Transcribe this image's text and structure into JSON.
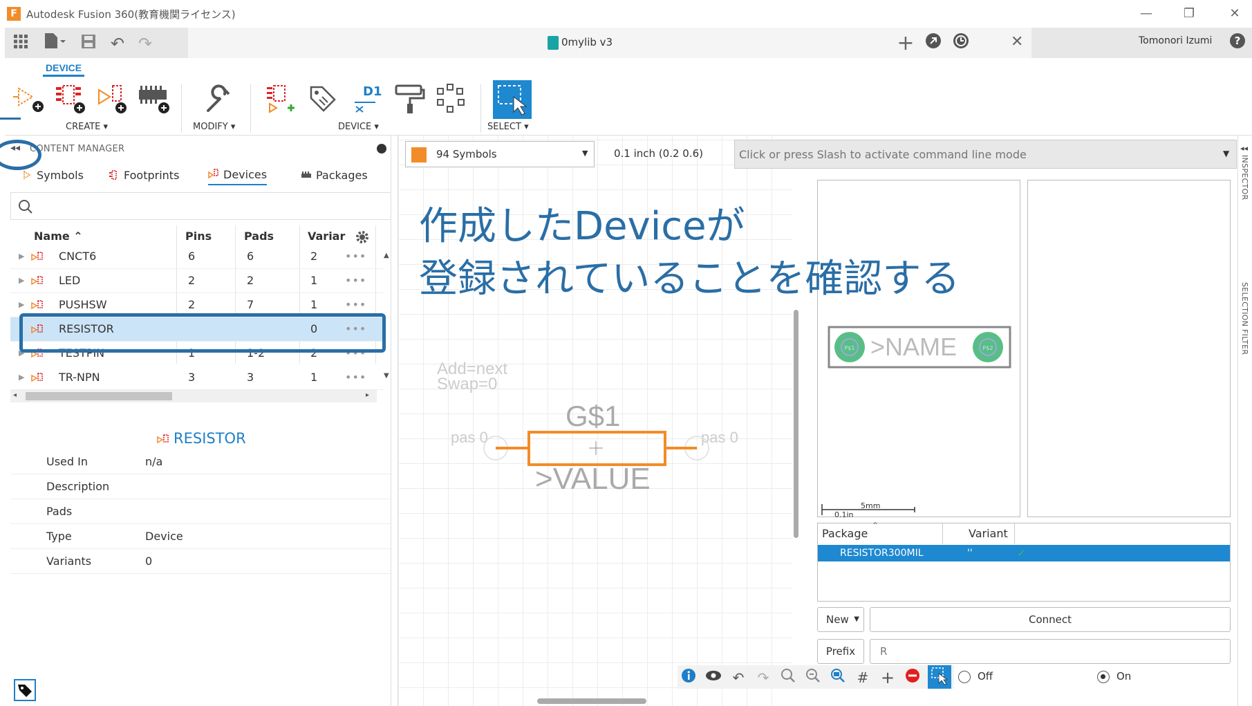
{
  "window": {
    "title": "Autodesk Fusion 360(教育機関ライセンス)",
    "app_icon": "F"
  },
  "tabbar": {
    "document_name": "0mylib v3",
    "user_name": "Tomonori Izumi"
  },
  "ribbon": {
    "active_tab": "DEVICE",
    "groups": {
      "create": "CREATE ▾",
      "modify": "MODIFY ▾",
      "device": "DEVICE ▾",
      "select": "SELECT ▾"
    },
    "d1_label": "D1"
  },
  "content_manager": {
    "title": "CONTENT MANAGER",
    "tabs": [
      "Symbols",
      "Footprints",
      "Devices",
      "Packages"
    ],
    "active_tab": "Devices",
    "columns": [
      "Name ⌃",
      "Pins",
      "Pads",
      "Variar"
    ],
    "rows": [
      {
        "name": "CNCT6",
        "pins": "6",
        "pads": "6",
        "variants": "2"
      },
      {
        "name": "LED",
        "pins": "2",
        "pads": "2",
        "variants": "1"
      },
      {
        "name": "PUSHSW",
        "pins": "2",
        "pads": "7",
        "variants": "1"
      },
      {
        "name": "RESISTOR",
        "pins": "",
        "pads": "",
        "variants": "0"
      },
      {
        "name": "TESTPIN",
        "pins": "1",
        "pads": "1-2",
        "variants": "2"
      },
      {
        "name": "TR-NPN",
        "pins": "3",
        "pads": "3",
        "variants": "1"
      }
    ],
    "selected_row": "RESISTOR",
    "details": {
      "title": "RESISTOR",
      "fields": [
        {
          "key": "Used In",
          "value": "n/a"
        },
        {
          "key": "Description",
          "value": ""
        },
        {
          "key": "Pads",
          "value": ""
        },
        {
          "key": "Type",
          "value": "Device"
        },
        {
          "key": "Variants",
          "value": "0"
        }
      ]
    }
  },
  "canvas": {
    "layer_dropdown": "94 Symbols",
    "layer_color": "#f28c28",
    "grid_info": "0.1 inch (0.2 0.6)",
    "command_placeholder": "Click or press Slash to activate command line mode",
    "symbol": {
      "add_line": "Add=next",
      "swap_line": "Swap=0",
      "gate": "G$1",
      "value": ">VALUE",
      "pin_left": "pas 0",
      "pin_right": "pas 0"
    }
  },
  "annotation": {
    "line1": "作成したDeviceが",
    "line2": "登録されていることを確認する",
    "color": "#2a6ea6"
  },
  "package_panel": {
    "footprint_name": ">NAME",
    "pad_labels": [
      "P$1",
      "P$2"
    ],
    "scale_mm": "5mm",
    "scale_in": "0.1in",
    "table_headers": [
      "Package",
      "Variant"
    ],
    "package_row": {
      "package": "RESISTOR300MIL",
      "variant": "''"
    },
    "new_button": "New",
    "connect_button": "Connect",
    "prefix_button": "Prefix",
    "prefix_value": "R",
    "radio_off": "Off",
    "radio_on": "On"
  },
  "sidebar": {
    "inspector": "INSPECTOR",
    "selection_filter": "SELECTION FILTER"
  },
  "colors": {
    "accent": "#1e7fc8",
    "selection": "#1e88d0",
    "symbol_orange": "#f28c28",
    "footprint_green": "#3cb371"
  }
}
